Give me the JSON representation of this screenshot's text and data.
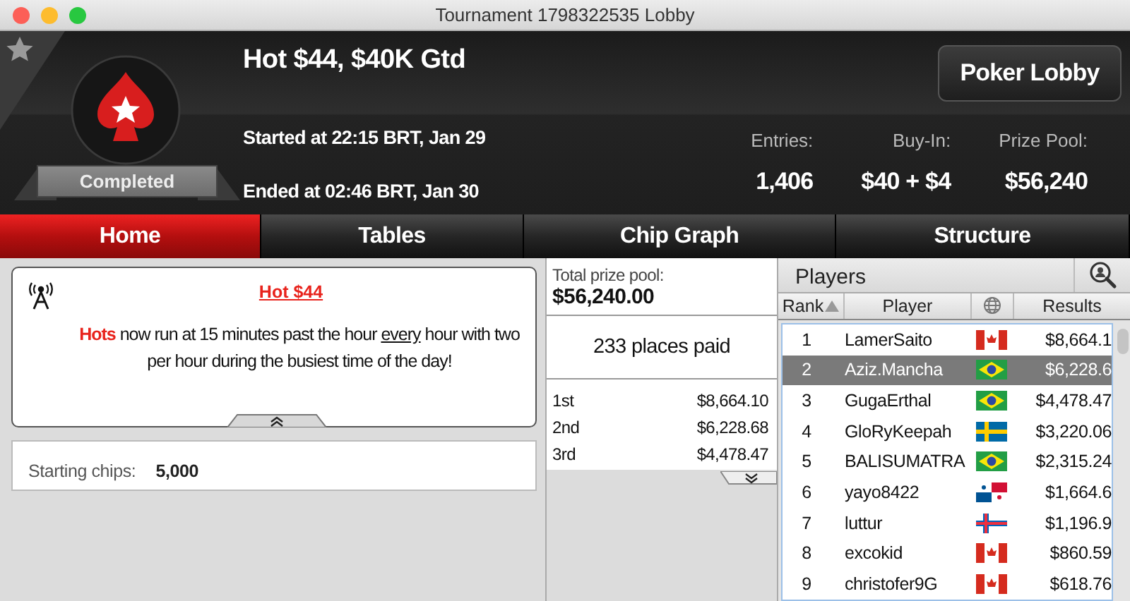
{
  "window": {
    "title": "Tournament 1798322535 Lobby"
  },
  "header": {
    "name": "Hot $44, $40K Gtd",
    "status": "Completed",
    "started": "Started at 22:15 BRT, Jan 29",
    "ended": "Ended at 02:46 BRT, Jan 30",
    "lobby_button": "Poker Lobby",
    "stats": [
      {
        "label": "Entries:",
        "value": "1,406"
      },
      {
        "label": "Buy-In:",
        "value": "$40 + $4"
      },
      {
        "label": "Prize Pool:",
        "value": "$56,240"
      }
    ]
  },
  "tabs": [
    {
      "label": "Home",
      "selected": true
    },
    {
      "label": "Tables",
      "selected": false
    },
    {
      "label": "Chip Graph",
      "selected": false
    },
    {
      "label": "Structure",
      "selected": false
    }
  ],
  "news": {
    "title": "Hot $44",
    "message": "**Hots** now run at 15 minutes past the hour *every* hour with two per hour during the busiest time of the day!"
  },
  "starting_chips": {
    "label": "Starting chips:",
    "value": "5,000"
  },
  "prizes": {
    "total_label": "Total prize pool:",
    "total": "$56,240.00",
    "places_paid": "233 places paid",
    "rows": [
      {
        "place": "1st",
        "amount": "$8,664.10"
      },
      {
        "place": "2nd",
        "amount": "$6,228.68"
      },
      {
        "place": "3rd",
        "amount": "$4,478.47"
      }
    ]
  },
  "players": {
    "title": "Players",
    "columns": [
      "Rank",
      "Player",
      "Results"
    ],
    "rows": [
      {
        "rank": "1",
        "player": "LamerSaito",
        "kind": "ca",
        "result": "$8,664.1",
        "selected": false
      },
      {
        "rank": "2",
        "player": "Aziz.Mancha",
        "kind": "br",
        "result": "$6,228.6",
        "selected": true
      },
      {
        "rank": "3",
        "player": "GugaErthal",
        "kind": "br",
        "result": "$4,478.47",
        "selected": false
      },
      {
        "rank": "4",
        "player": "GloRyKeepah",
        "kind": "se",
        "result": "$3,220.06",
        "selected": false
      },
      {
        "rank": "5",
        "player": "BALISUMATRA",
        "kind": "br",
        "result": "$2,315.24",
        "selected": false
      },
      {
        "rank": "6",
        "player": "yayo8422",
        "kind": "pa",
        "result": "$1,664.6",
        "selected": false
      },
      {
        "rank": "7",
        "player": "luttur",
        "kind": "fo",
        "result": "$1,196.9",
        "selected": false
      },
      {
        "rank": "8",
        "player": "excokid",
        "kind": "ca",
        "result": "$860.59",
        "selected": false
      },
      {
        "rank": "9",
        "player": "christofer9G",
        "kind": "ca",
        "result": "$618.76",
        "selected": false
      }
    ]
  }
}
